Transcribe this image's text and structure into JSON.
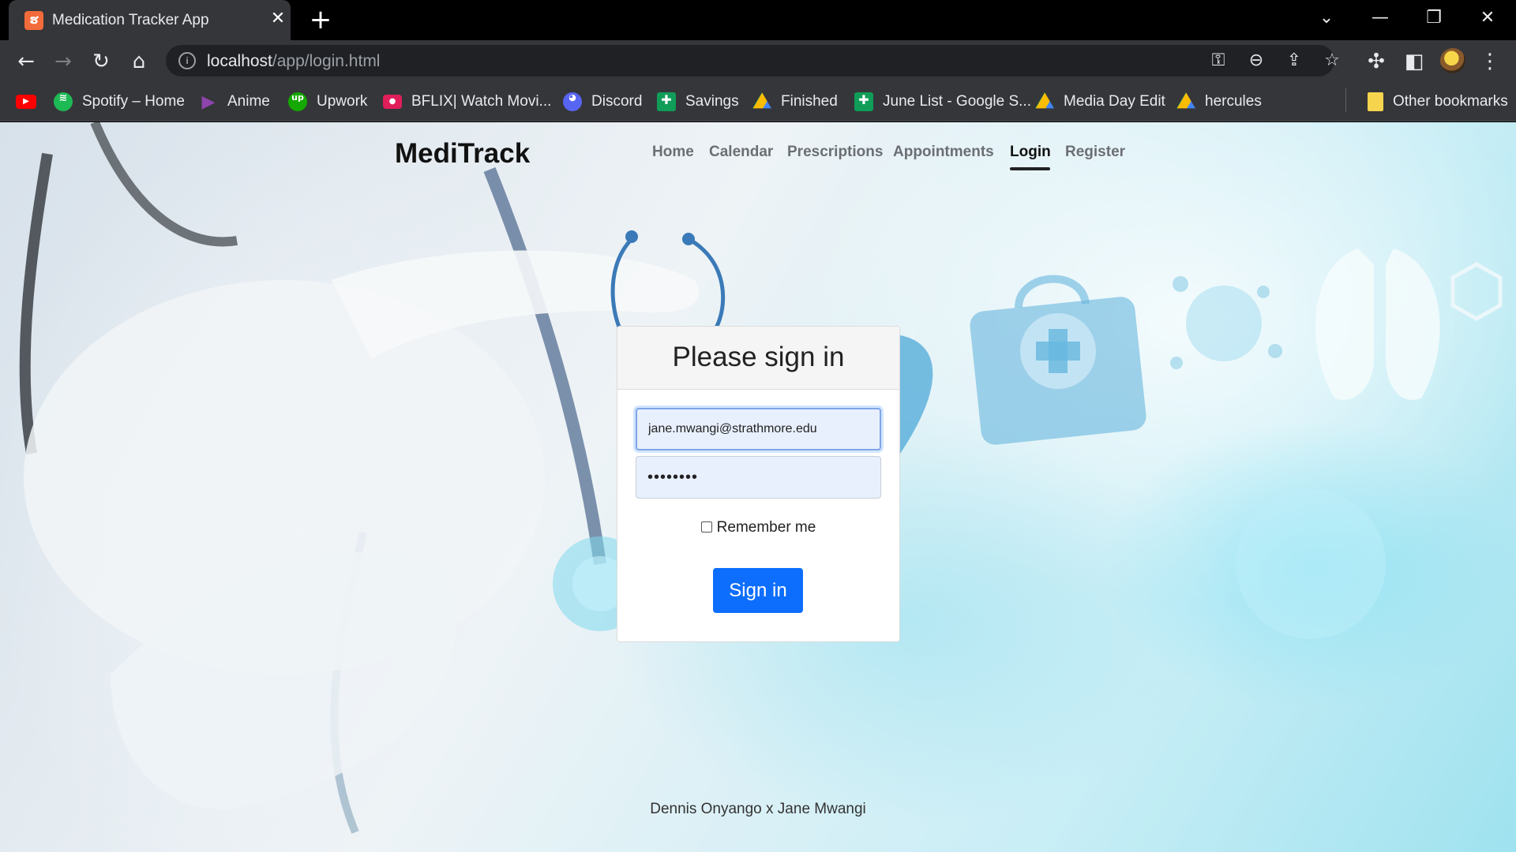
{
  "browser": {
    "tab_title": "Medication Tracker App",
    "url_host": "localhost",
    "url_path": "/app/login.html",
    "bookmarks": [
      {
        "label": "",
        "icon": "youtube-icon",
        "color": "#ff0000"
      },
      {
        "label": "Spotify – Home",
        "icon": "spotify-icon",
        "color": "#1db954"
      },
      {
        "label": "Anime",
        "icon": "play-icon",
        "color": "#8e44ad"
      },
      {
        "label": "Upwork",
        "icon": "upwork-icon",
        "color": "#14a800"
      },
      {
        "label": "BFLIX| Watch Movi...",
        "icon": "bflix-icon",
        "color": "#e01e5a"
      },
      {
        "label": "Discord",
        "icon": "discord-icon",
        "color": "#5865f2"
      },
      {
        "label": "Savings",
        "icon": "sheets-icon",
        "color": "#0f9d58"
      },
      {
        "label": "Finished",
        "icon": "drive-icon",
        "color": "#fbbc04"
      },
      {
        "label": "June List - Google S...",
        "icon": "sheets-icon",
        "color": "#0f9d58"
      },
      {
        "label": "Media Day Edit",
        "icon": "drive-icon",
        "color": "#fbbc04"
      },
      {
        "label": "hercules",
        "icon": "drive-icon",
        "color": "#fbbc04"
      }
    ],
    "other_bookmarks": "Other bookmarks"
  },
  "app": {
    "brand": "MediTrack",
    "nav": [
      "Home",
      "Calendar",
      "Prescriptions",
      "Appointments",
      "Login",
      "Register"
    ],
    "active_nav": "Login"
  },
  "login": {
    "heading": "Please sign in",
    "email_value": "jane.mwangi@strathmore.edu",
    "password_value": "••••••••",
    "remember_label": "Remember me",
    "submit_label": "Sign in"
  },
  "footer": {
    "credit": "Dennis Onyango x Jane Mwangi"
  }
}
